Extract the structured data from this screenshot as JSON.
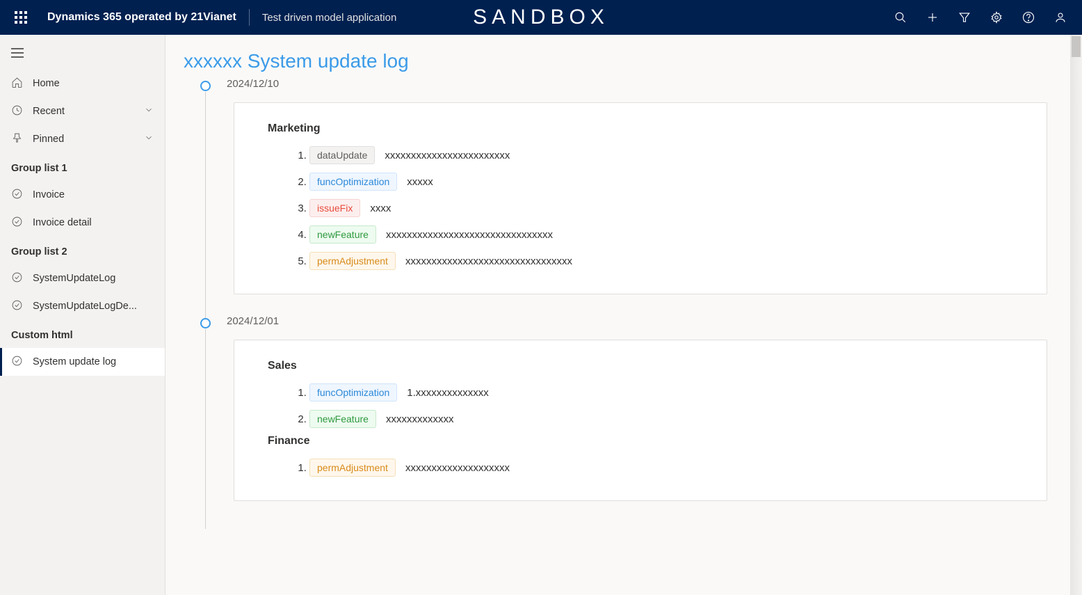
{
  "header": {
    "product": "Dynamics 365 operated by 21Vianet",
    "appName": "Test driven model application",
    "envLabel": "SANDBOX"
  },
  "sidebar": {
    "topItems": [
      {
        "icon": "home",
        "label": "Home",
        "chevron": false
      },
      {
        "icon": "clock",
        "label": "Recent",
        "chevron": true
      },
      {
        "icon": "pin",
        "label": "Pinned",
        "chevron": true
      }
    ],
    "groups": [
      {
        "header": "Group list 1",
        "items": [
          {
            "icon": "entity",
            "label": "Invoice"
          },
          {
            "icon": "entity",
            "label": "Invoice detail"
          }
        ]
      },
      {
        "header": "Group list 2",
        "items": [
          {
            "icon": "entity",
            "label": "SystemUpdateLog"
          },
          {
            "icon": "entity",
            "label": "SystemUpdateLogDe..."
          }
        ]
      },
      {
        "header": "Custom html",
        "items": [
          {
            "icon": "entity",
            "label": "System update log",
            "selected": true
          }
        ]
      }
    ]
  },
  "page": {
    "title": "xxxxxx System update log",
    "entries": [
      {
        "date": "2024/12/10",
        "sections": [
          {
            "title": "Marketing",
            "items": [
              {
                "tag": "dataUpdate",
                "desc": "xxxxxxxxxxxxxxxxxxxxxxxx"
              },
              {
                "tag": "funcOptimization",
                "desc": "xxxxx"
              },
              {
                "tag": "issueFix",
                "desc": "xxxx"
              },
              {
                "tag": "newFeature",
                "desc": "xxxxxxxxxxxxxxxxxxxxxxxxxxxxxxxx"
              },
              {
                "tag": "permAdjustment",
                "desc": "xxxxxxxxxxxxxxxxxxxxxxxxxxxxxxxx"
              }
            ]
          }
        ]
      },
      {
        "date": "2024/12/01",
        "sections": [
          {
            "title": "Sales",
            "items": [
              {
                "tag": "funcOptimization",
                "desc": "1.xxxxxxxxxxxxxx"
              },
              {
                "tag": "newFeature",
                "desc": "xxxxxxxxxxxxx"
              }
            ]
          },
          {
            "title": "Finance",
            "items": [
              {
                "tag": "permAdjustment",
                "desc": "xxxxxxxxxxxxxxxxxxxx"
              }
            ]
          }
        ]
      }
    ]
  }
}
